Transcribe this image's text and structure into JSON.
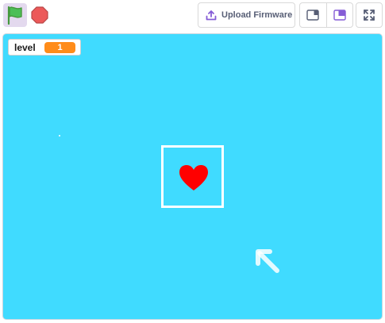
{
  "toolbar": {
    "green_flag_icon": "green-flag-icon",
    "stop_icon": "stop-icon",
    "upload": {
      "label": "Upload Firmware",
      "icon": "upload-icon"
    },
    "layout_buttons": [
      "small-stage-icon",
      "large-stage-icon"
    ],
    "fullscreen_icon": "fullscreen-icon"
  },
  "stage": {
    "background_color": "#40dbff",
    "variable_monitor": {
      "label": "level",
      "value": "1"
    },
    "sprites": [
      "heart-icon",
      "arrow-icon"
    ]
  },
  "colors": {
    "flag_green": "#4cbf56",
    "stop_red": "#ec5959",
    "monitor_orange": "#ff8c1a",
    "heart_red": "#ff0000",
    "accent_purple": "#9966ff"
  }
}
